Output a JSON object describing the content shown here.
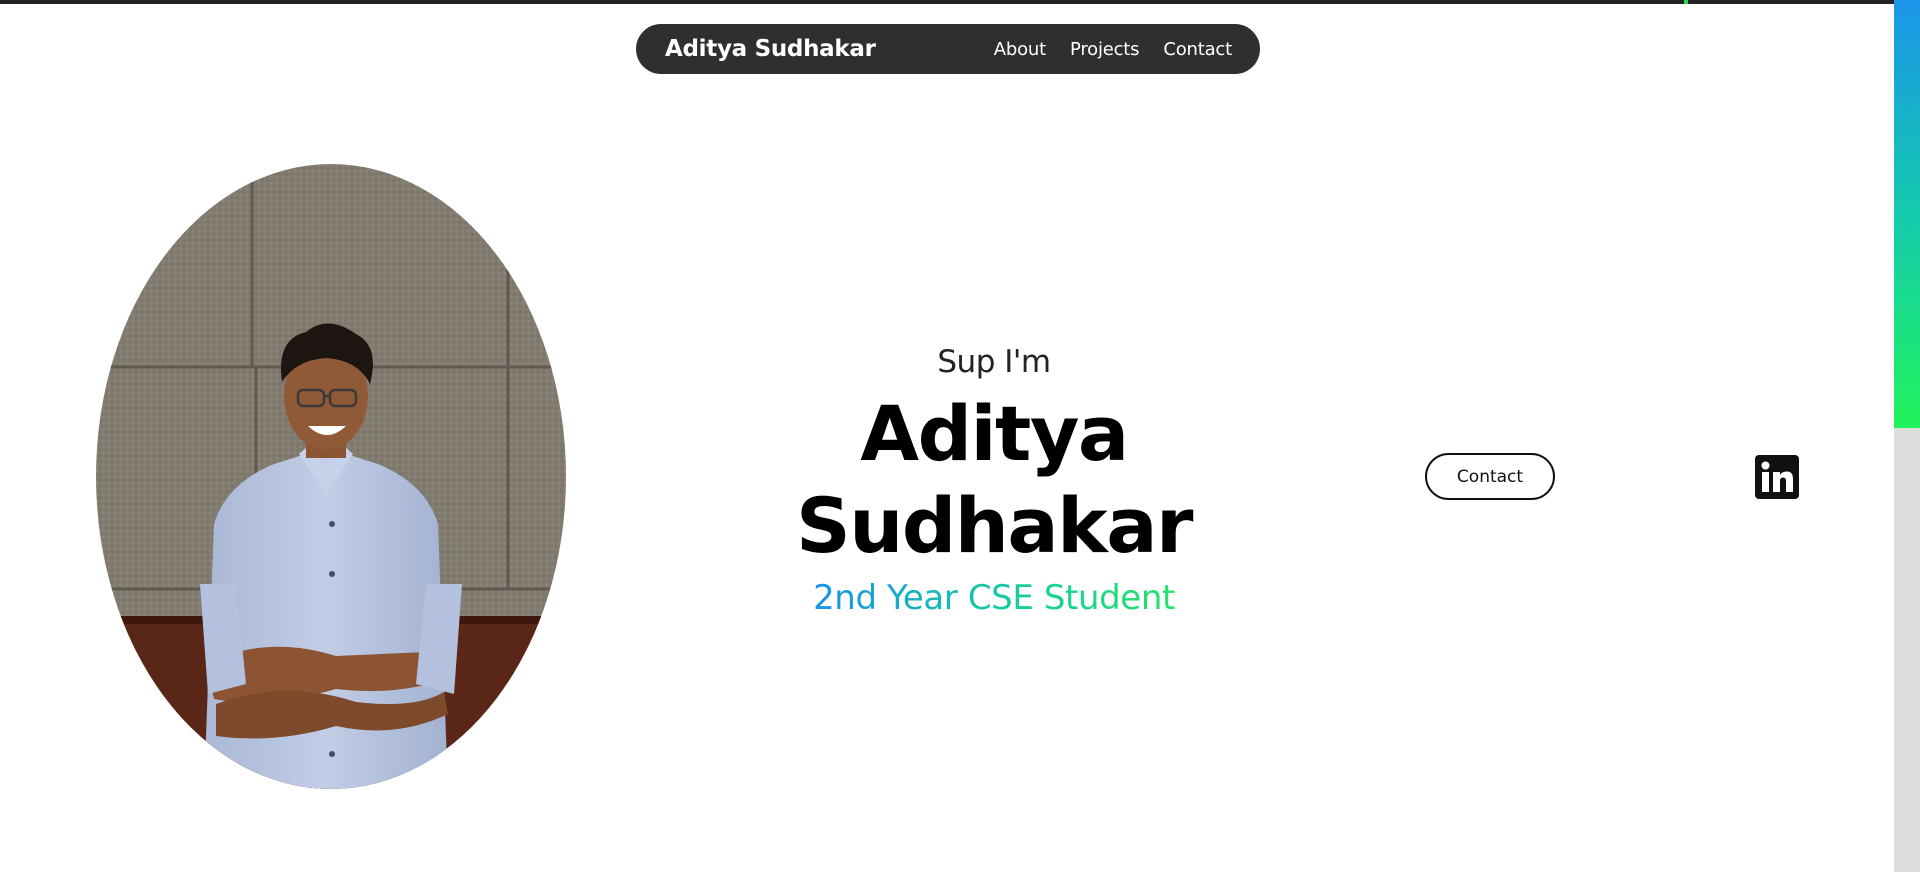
{
  "nav": {
    "brand": "Aditya Sudhakar",
    "links": [
      "About",
      "Projects",
      "Contact"
    ]
  },
  "hero": {
    "greeting": "Sup I'm",
    "name_line1": "Aditya",
    "name_line2": "Sudhakar",
    "subtitle": "2nd Year CSE Student",
    "subtitle_gradient": [
      "#1892e8",
      "#16c8a4",
      "#22e46a"
    ]
  },
  "actions": {
    "contact_label": "Contact",
    "social_icon": "linkedin-icon"
  },
  "colors": {
    "nav_background": "#2f2f2f",
    "text_primary": "#000000",
    "scroll_thumb_top": "#1b95ea",
    "scroll_thumb_bottom": "#23f25b"
  },
  "portrait": {
    "icon": "portrait-photo"
  }
}
